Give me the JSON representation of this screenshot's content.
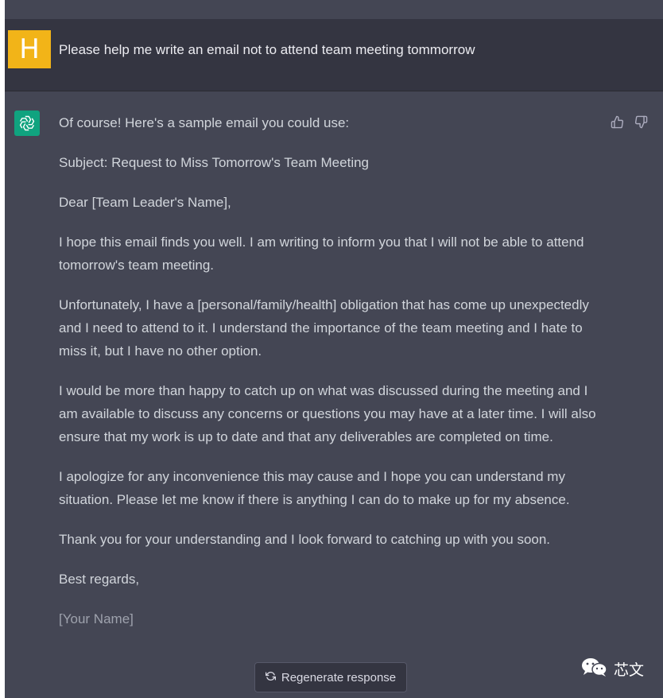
{
  "conversation": {
    "user": {
      "avatar_letter": "H",
      "avatar_color": "#f2b418",
      "message": "Please help me write an email not to attend team meeting tommorrow"
    },
    "assistant": {
      "avatar_icon": "openai-logo-icon",
      "avatar_color": "#10a37f",
      "paragraphs": [
        "Of course! Here's a sample email you could use:",
        "Subject: Request to Miss Tomorrow's Team Meeting",
        "Dear [Team Leader's Name],",
        "I hope this email finds you well. I am writing to inform you that I will not be able to attend tomorrow's team meeting.",
        "Unfortunately, I have a [personal/family/health] obligation that has come up unexpectedly and I need to attend to it. I understand the importance of the team meeting and I hate to miss it, but I have no other option.",
        "I would be more than happy to catch up on what was discussed during the meeting and I am available to discuss any concerns or questions you may have at a later time. I will also ensure that my work is up to date and that any deliverables are completed on time.",
        "I apologize for any inconvenience this may cause and I hope you can understand my situation. Please let me know if there is anything I can do to make up for my absence.",
        "Thank you for your understanding and I look forward to catching up with you soon.",
        "Best regards,",
        "[Your Name]"
      ],
      "feedback_icons": [
        "thumbs-up-icon",
        "thumbs-down-icon"
      ]
    }
  },
  "controls": {
    "regenerate_label": "Regenerate response",
    "regenerate_icon": "refresh-icon"
  },
  "watermark": {
    "icon": "wechat-icon",
    "text": "芯文"
  },
  "colors": {
    "assistant_bg": "#444654",
    "user_bg": "#343541",
    "text": "#d1d5db"
  }
}
